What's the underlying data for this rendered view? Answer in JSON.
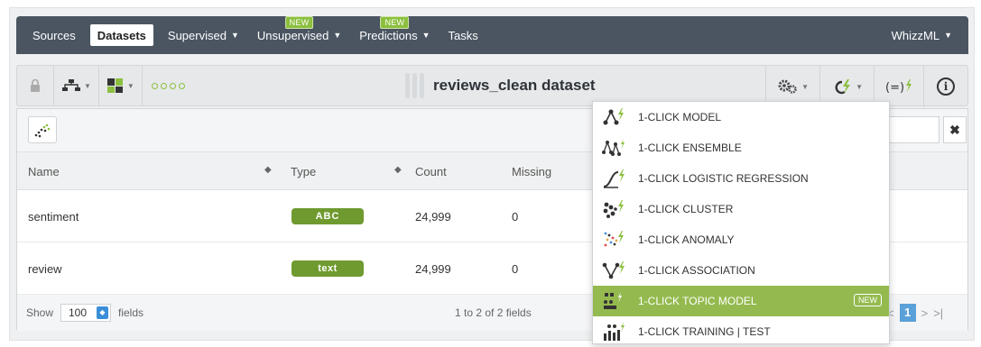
{
  "nav": {
    "items": [
      {
        "label": "Sources",
        "caret": false,
        "active": false,
        "new": false
      },
      {
        "label": "Datasets",
        "caret": false,
        "active": true,
        "new": false
      },
      {
        "label": "Supervised",
        "caret": true,
        "active": false,
        "new": false
      },
      {
        "label": "Unsupervised",
        "caret": true,
        "active": false,
        "new": true
      },
      {
        "label": "Predictions",
        "caret": true,
        "active": false,
        "new": true
      },
      {
        "label": "Tasks",
        "caret": false,
        "active": false,
        "new": false
      }
    ],
    "new_badge": "NEW",
    "whizzml": "WhizzML"
  },
  "toolbar": {
    "dataset_title": "reviews_clean dataset"
  },
  "table": {
    "headers": {
      "name": "Name",
      "type": "Type",
      "count": "Count",
      "missing": "Missing"
    },
    "rows": [
      {
        "name": "sentiment",
        "type": "ABC",
        "count": "24,999",
        "missing": "0"
      },
      {
        "name": "review",
        "type": "text",
        "count": "24,999",
        "missing": "0"
      }
    ]
  },
  "footer": {
    "show": "Show",
    "page_size": "100",
    "fields": "fields",
    "range": "1 to 2 of 2 fields",
    "current_page": "1"
  },
  "dropdown": {
    "items": [
      {
        "label": "1-CLICK MODEL",
        "icon": "model-icon"
      },
      {
        "label": "1-CLICK ENSEMBLE",
        "icon": "ensemble-icon"
      },
      {
        "label": "1-CLICK LOGISTIC REGRESSION",
        "icon": "logistic-regression-icon"
      },
      {
        "label": "1-CLICK CLUSTER",
        "icon": "cluster-icon"
      },
      {
        "label": "1-CLICK ANOMALY",
        "icon": "anomaly-icon"
      },
      {
        "label": "1-CLICK ASSOCIATION",
        "icon": "association-icon"
      },
      {
        "label": "1-CLICK TOPIC MODEL",
        "icon": "topic-model-icon",
        "highlighted": true,
        "new": true
      },
      {
        "label": "1-CLICK TRAINING | TEST",
        "icon": "training-test-icon"
      }
    ],
    "new_badge": "NEW"
  },
  "colors": {
    "nav_bg": "#4a5561",
    "accent_green": "#8cbf3f",
    "highlight_green": "#94ba4f",
    "pill_green": "#6f9a2f",
    "pager_blue": "#5aa0d9"
  }
}
